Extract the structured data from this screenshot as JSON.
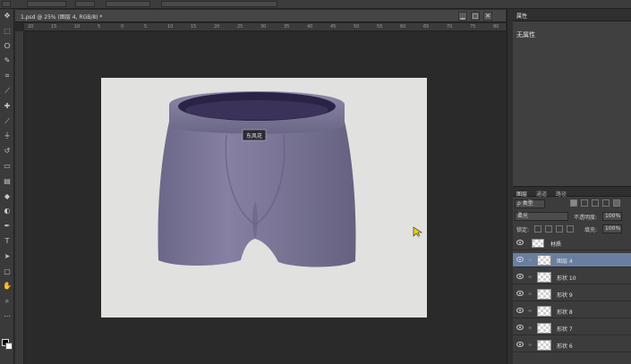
{
  "options_bar": {
    "color": "#3c3c3c"
  },
  "document": {
    "tab_title": "1.psd @ 25% (图层 4, RGB/8) *",
    "close_glyph": "✕",
    "minimize_glyph": "▁",
    "restore_glyph": "□",
    "ruler_marks": [
      "20",
      "15",
      "10",
      "5",
      "0",
      "5",
      "10",
      "15",
      "20",
      "25",
      "30",
      "35",
      "40",
      "45",
      "50",
      "55",
      "60",
      "65",
      "70",
      "75",
      "80"
    ]
  },
  "tools": [
    {
      "name": "move-tool-icon",
      "glyph": "✥"
    },
    {
      "name": "marquee-tool-icon",
      "glyph": "⬚"
    },
    {
      "name": "lasso-tool-icon",
      "glyph": "ⵔ"
    },
    {
      "name": "quick-select-tool-icon",
      "glyph": "✎"
    },
    {
      "name": "crop-tool-icon",
      "glyph": "⌗"
    },
    {
      "name": "eyedropper-tool-icon",
      "glyph": "⟋"
    },
    {
      "name": "healing-brush-tool-icon",
      "glyph": "✚"
    },
    {
      "name": "brush-tool-icon",
      "glyph": "⟋"
    },
    {
      "name": "clone-stamp-tool-icon",
      "glyph": "⏚"
    },
    {
      "name": "history-brush-tool-icon",
      "glyph": "↺"
    },
    {
      "name": "eraser-tool-icon",
      "glyph": "▭"
    },
    {
      "name": "gradient-tool-icon",
      "glyph": "▤"
    },
    {
      "name": "blur-tool-icon",
      "glyph": "◆"
    },
    {
      "name": "dodge-tool-icon",
      "glyph": "◐"
    },
    {
      "name": "pen-tool-icon",
      "glyph": "✒"
    },
    {
      "name": "type-tool-icon",
      "glyph": "T"
    },
    {
      "name": "path-select-tool-icon",
      "glyph": "➤"
    },
    {
      "name": "shape-tool-icon",
      "glyph": "▢"
    },
    {
      "name": "hand-tool-icon",
      "glyph": "✋"
    },
    {
      "name": "zoom-tool-icon",
      "glyph": "⌕"
    },
    {
      "name": "extra-tool-icon",
      "glyph": "⋯"
    }
  ],
  "properties_panel": {
    "tab": "属性",
    "empty_text": "无属性"
  },
  "layers_panel": {
    "tabs": [
      "图层",
      "通道",
      "路径"
    ],
    "filter_label": "ρ 类型",
    "blend_mode": "柔光",
    "opacity_label": "不透明度:",
    "opacity_value": "100%",
    "lock_label": "锁定:",
    "fill_label": "填充:",
    "fill_value": "100%",
    "layers": [
      {
        "name": "材质",
        "type": "group",
        "selected": false
      },
      {
        "name": "图层 4",
        "type": "layer",
        "selected": true
      },
      {
        "name": "形状 10",
        "type": "shape",
        "selected": false
      },
      {
        "name": "形状 9",
        "type": "shape",
        "selected": false
      },
      {
        "name": "形状 8",
        "type": "shape",
        "selected": false
      },
      {
        "name": "形状 7",
        "type": "shape",
        "selected": false
      },
      {
        "name": "形状 6",
        "type": "shape",
        "selected": false
      }
    ]
  },
  "product": {
    "label": "东风花"
  },
  "colors": {
    "fabric": "#7a7596",
    "canvas": "#e1e2df",
    "selection": "#6a7f9f"
  }
}
